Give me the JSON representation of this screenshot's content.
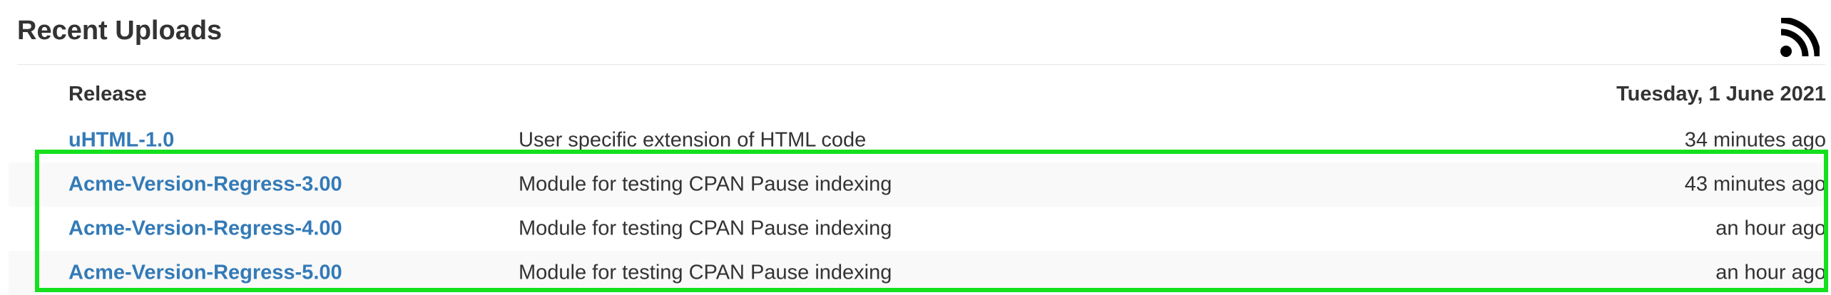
{
  "section": {
    "title": "Recent Uploads",
    "rss_icon": "rss-feed-icon"
  },
  "table": {
    "header": {
      "release": "Release",
      "date": "Tuesday, 1 June 2021"
    },
    "rows": [
      {
        "name": "uHTML-1.0",
        "description": "User specific extension of HTML code",
        "time": "34 minutes ago"
      },
      {
        "name": "Acme-Version-Regress-3.00",
        "description": "Module for testing CPAN Pause indexing",
        "time": "43 minutes ago"
      },
      {
        "name": "Acme-Version-Regress-4.00",
        "description": "Module for testing CPAN Pause indexing",
        "time": "an hour ago"
      },
      {
        "name": "Acme-Version-Regress-5.00",
        "description": "Module for testing CPAN Pause indexing",
        "time": "an hour ago"
      }
    ]
  },
  "colors": {
    "link": "#337ab7",
    "text": "#333333",
    "stripe": "#f9f9f9",
    "highlight": "#14e01e"
  }
}
